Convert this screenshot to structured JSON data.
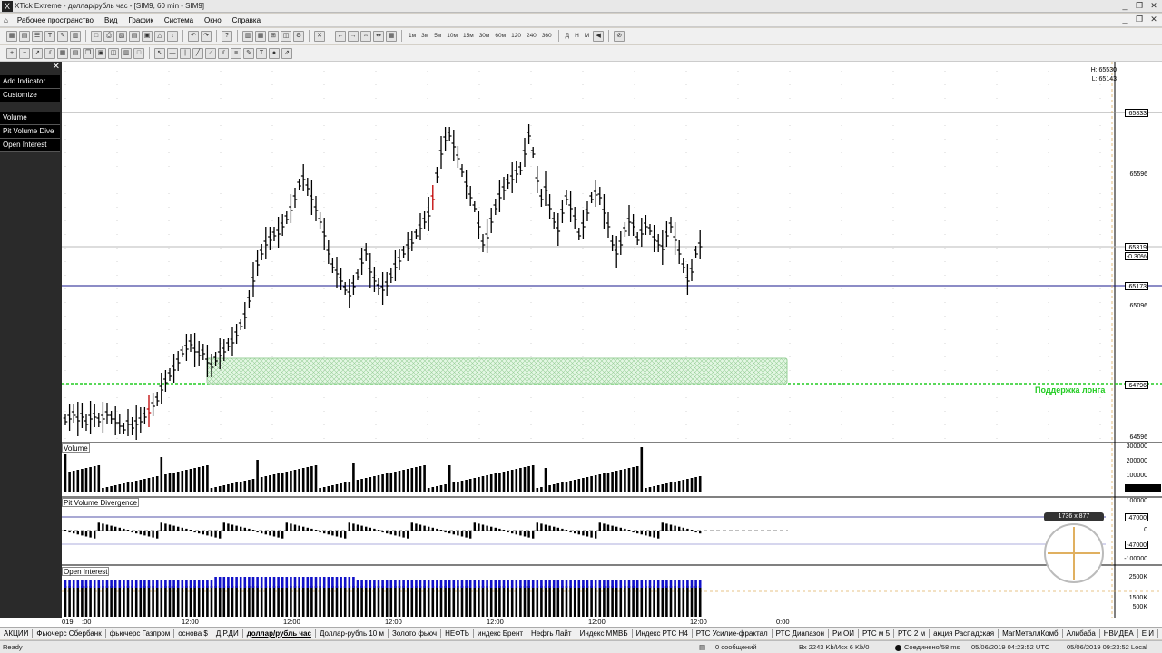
{
  "window": {
    "title": "XTick Extreme - доллар/рубль час - [SIM9, 60 min - SIM9]",
    "controls": [
      "_",
      "❐",
      "✕"
    ],
    "inner_controls": [
      "_",
      "❐",
      "✕"
    ]
  },
  "menu": [
    "Рабочее пространство",
    "Вид",
    "График",
    "Система",
    "Окно",
    "Справка"
  ],
  "toolbar1_timeframes": [
    "1м",
    "3м",
    "5м",
    "10м",
    "15м",
    "30м",
    "60м",
    "120",
    "240",
    "360"
  ],
  "toolbar1_modes": [
    "Д",
    "Н",
    "М"
  ],
  "left_panel": {
    "close": "✕",
    "buttons_top": [
      "Add Indicator",
      "Customize"
    ],
    "buttons_indicators": [
      "Volume",
      "Pit Volume Dive",
      "Open Interest"
    ]
  },
  "chart_info": {
    "high": "H: 65530",
    "low": "L: 65143"
  },
  "price_axis": {
    "boxes": [
      {
        "label": "65833",
        "style": "box"
      },
      {
        "label": "65596",
        "style": "plain"
      },
      {
        "label": "65319",
        "style": "box"
      },
      {
        "label": "-0.30%",
        "style": "plain-box"
      },
      {
        "label": "65173",
        "style": "box"
      },
      {
        "label": "65096",
        "style": "plain"
      },
      {
        "label": "64796",
        "style": "box"
      },
      {
        "label": "64596",
        "style": "plain"
      }
    ]
  },
  "support_label": "Поддержка лонга",
  "panels": {
    "volume": {
      "name": "Volume",
      "axis": [
        "300000",
        "200000",
        "100000"
      ]
    },
    "pvd": {
      "name": "Pit Volume Divergence",
      "axis": [
        "100000",
        "47000",
        "0",
        "-47000",
        "-100000"
      ]
    },
    "oi": {
      "name": "Open Interest",
      "axis": [
        "2500K",
        "1500K",
        "500K"
      ]
    }
  },
  "time_axis": [
    "12:00",
    "12:00",
    "12:00",
    "12:00",
    "12:00",
    "12:00",
    "0:00"
  ],
  "time_axis_left": [
    "019",
    ":00"
  ],
  "crosshair_widget": {
    "label": "1736 x 877"
  },
  "colors": {
    "up": "#1a7a1a",
    "down": "#c00000",
    "bar": "#000000",
    "support": "#22cc22",
    "hline_blue": "#1a1a8c",
    "oi": "#1010c8"
  },
  "tabs": [
    "АКЦИИ",
    "Фьючерс Сбербанк",
    "фьючерс Газпром",
    "основа $",
    "Д.Р.ДИ",
    "доллар/рубль час",
    "Доллар-рубль 10 м",
    "Золото фьюч",
    "НЕФТЬ",
    "индекс Брент",
    "Нефть Лайт",
    "Индекс ММВБ",
    "Индекс РТС Н4",
    "РТС Усилие-фрактал",
    "РТС Диапазон",
    "Ри ОИ",
    "РТС м 5",
    "РТС 2 м",
    "акция Распадская",
    "МагМеталлКомб",
    "Алибаба",
    "НВИДЕА",
    "Е И"
  ],
  "active_tab": "доллар/рубль час",
  "status": {
    "ready": "Ready",
    "messages": "0 сообщений",
    "traffic": "Вх 2243 Kb/Исх 6 Kb/0",
    "connection": "Соединено/58 ms",
    "time1": "05/06/2019 04:23:52 UTC",
    "time2": "05/06/2019 09:23:52 Local"
  }
}
